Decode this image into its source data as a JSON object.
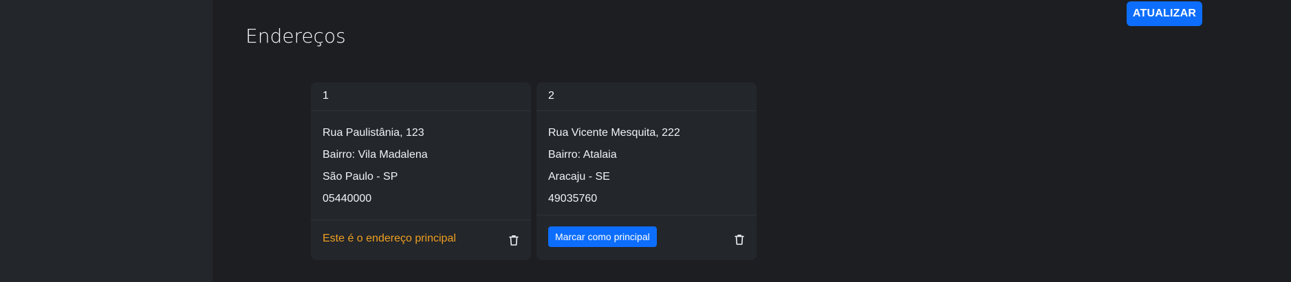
{
  "header": {
    "update_label": "ATUALIZAR"
  },
  "page": {
    "title": "Endereços"
  },
  "addresses": [
    {
      "index": "1",
      "street": "Rua Paulistânia, 123",
      "neighborhood": "Bairro: Vila Madalena",
      "city_state": "São Paulo - SP",
      "zip": "05440000",
      "is_principal": true,
      "principal_text": "Este é o endereço principal",
      "delete_icon": "trash-icon"
    },
    {
      "index": "2",
      "street": "Rua Vicente Mesquita, 222",
      "neighborhood": "Bairro: Atalaia",
      "city_state": "Aracaju - SE",
      "zip": "49035760",
      "is_principal": false,
      "mark_principal_label": "Marcar como principal",
      "delete_icon": "trash-icon"
    }
  ],
  "colors": {
    "page_bg": "#1c1e22",
    "sidebar_bg": "#23262b",
    "card_bg": "#23262b",
    "accent": "#0d6efd",
    "principal_text": "#f0a020"
  }
}
